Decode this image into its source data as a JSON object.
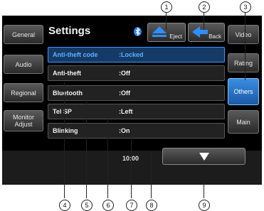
{
  "screen": {
    "title": "Settings",
    "top_buttons": {
      "eject": "Eject",
      "back": "Back"
    },
    "left_tabs": [
      "General",
      "Audio",
      "Regional",
      "Monitor Adjust"
    ],
    "right_tabs": [
      "Video",
      "Rating",
      "Others",
      "Main"
    ],
    "active_right_tab": "Others",
    "rows": [
      {
        "key": "Anti-theft code",
        "value": ":Locked",
        "selected": true
      },
      {
        "key": "Anti-theft",
        "value": ":Off",
        "selected": false
      },
      {
        "key": "Bluetooth",
        "value": ":Off",
        "selected": false
      },
      {
        "key": "Tel SP",
        "value": ":Left",
        "selected": false
      },
      {
        "key": "Blinking",
        "value": ":On",
        "selected": false
      }
    ],
    "clock": "10:00",
    "icons": [
      "bluetooth-icon",
      "eject-icon",
      "back-arrow-icon",
      "down-arrow-icon"
    ],
    "accent": "#3f95ff"
  },
  "callouts": {
    "top": [
      "1",
      "2",
      "3"
    ],
    "bottom": [
      "4",
      "5",
      "6",
      "7",
      "8",
      "9"
    ]
  }
}
